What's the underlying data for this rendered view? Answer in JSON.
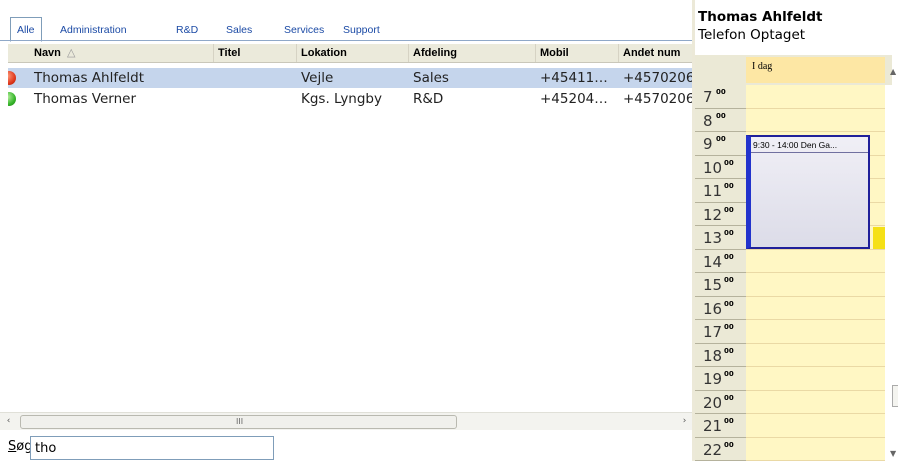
{
  "tabs": [
    {
      "label": "Alle",
      "active": true
    },
    {
      "label": "Administration"
    },
    {
      "label": "R&D"
    },
    {
      "label": "Sales"
    },
    {
      "label": "Services"
    },
    {
      "label": "Support"
    }
  ],
  "grid": {
    "columns": [
      "Navn",
      "Titel",
      "Lokation",
      "Afdeling",
      "Mobil",
      "Andet num"
    ],
    "sort_indicator": "△",
    "rows": [
      {
        "status": "busy",
        "status_color": "#e03a1e",
        "cells": [
          "Thomas Ahlfeldt",
          "",
          "Vejle",
          "Sales",
          "+45411…",
          "+4570206"
        ],
        "selected": true
      },
      {
        "status": "available",
        "status_color": "#36b52a",
        "cells": [
          "Thomas Verner",
          "",
          "Kgs. Lyngby",
          "R&D",
          "+45204…",
          "+4570206"
        ],
        "selected": false
      }
    ]
  },
  "scrollbar": {
    "left_arrow": "‹",
    "right_arrow": "›",
    "grip": "III"
  },
  "search": {
    "label": "Søg",
    "value": "tho"
  },
  "contact": {
    "name": "Thomas Ahlfeldt",
    "status": "Telefon Optaget"
  },
  "calendar": {
    "day_label": "I dag",
    "hours": [
      "7",
      "8",
      "9",
      "10",
      "11",
      "12",
      "13",
      "14",
      "15",
      "16",
      "17",
      "18",
      "19",
      "20",
      "21",
      "22"
    ],
    "minute_marker": "00",
    "appointment": {
      "text": "9:30 - 14:00 Den Ga..."
    }
  },
  "colors": {
    "selection": "#c5d5ec",
    "calendar_slot": "#fff7c4",
    "appointment_border": "#20209a"
  }
}
